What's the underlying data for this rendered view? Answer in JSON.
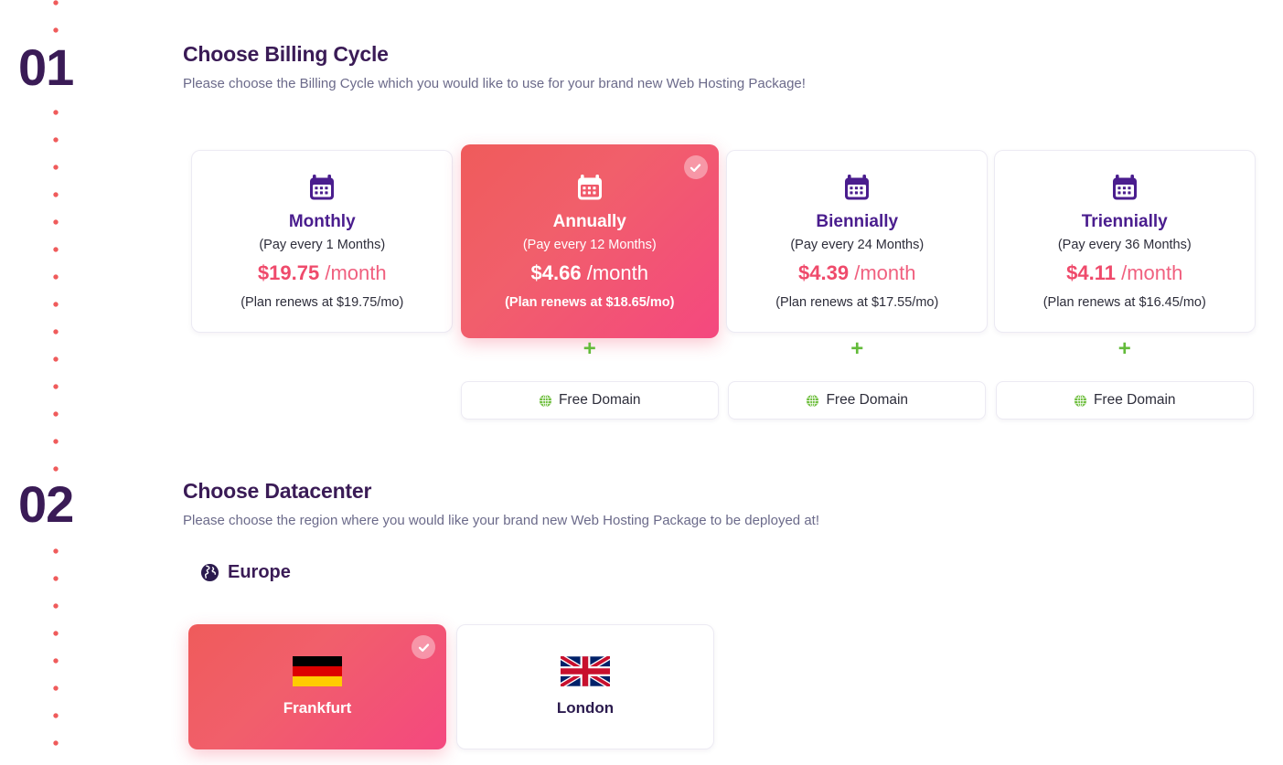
{
  "theme": {
    "accent_purple": "#3a1b56",
    "accent_pink": "#ef4a6b",
    "gradient_start": "#ef5b5b",
    "gradient_end": "#f4487f",
    "green": "#63bb3a",
    "timeline_dot": "#ef5b5b",
    "background": "#ffffff"
  },
  "steps": [
    {
      "number": "01",
      "title": "Choose Billing Cycle",
      "subtitle": "Please choose the Billing Cycle which you would like to use for your brand new Web Hosting Package!"
    },
    {
      "number": "02",
      "title": "Choose Datacenter",
      "subtitle": "Please choose the region where you would like your brand new Web Hosting Package to be deployed at!"
    }
  ],
  "billing_cycles": [
    {
      "name": "Monthly",
      "period": "(Pay every 1 Months)",
      "price": "$19.75",
      "price_suffix": "/month",
      "renews": "(Plan renews at $19.75/mo)",
      "selected": false,
      "icon": "calendar-icon",
      "addon": null
    },
    {
      "name": "Annually",
      "period": "(Pay every 12 Months)",
      "price": "$4.66",
      "price_suffix": "/month",
      "renews": "(Plan renews at $18.65/mo)",
      "selected": true,
      "icon": "calendar-icon",
      "addon": {
        "plus": "+",
        "label": "Free Domain",
        "icon": "globe-icon"
      }
    },
    {
      "name": "Biennially",
      "period": "(Pay every 24 Months)",
      "price": "$4.39",
      "price_suffix": "/month",
      "renews": "(Plan renews at $17.55/mo)",
      "selected": false,
      "icon": "calendar-icon",
      "addon": {
        "plus": "+",
        "label": "Free Domain",
        "icon": "globe-icon"
      }
    },
    {
      "name": "Triennially",
      "period": "(Pay every 36 Months)",
      "price": "$4.11",
      "price_suffix": "/month",
      "renews": "(Plan renews at $16.45/mo)",
      "selected": false,
      "icon": "calendar-icon",
      "addon": {
        "plus": "+",
        "label": "Free Domain",
        "icon": "globe-icon"
      }
    }
  ],
  "region": {
    "name": "Europe",
    "icon": "globe-europe-icon"
  },
  "datacenters": [
    {
      "name": "Frankfurt",
      "flag": "flag-germany",
      "selected": true
    },
    {
      "name": "London",
      "flag": "flag-united-kingdom",
      "selected": false
    }
  ]
}
